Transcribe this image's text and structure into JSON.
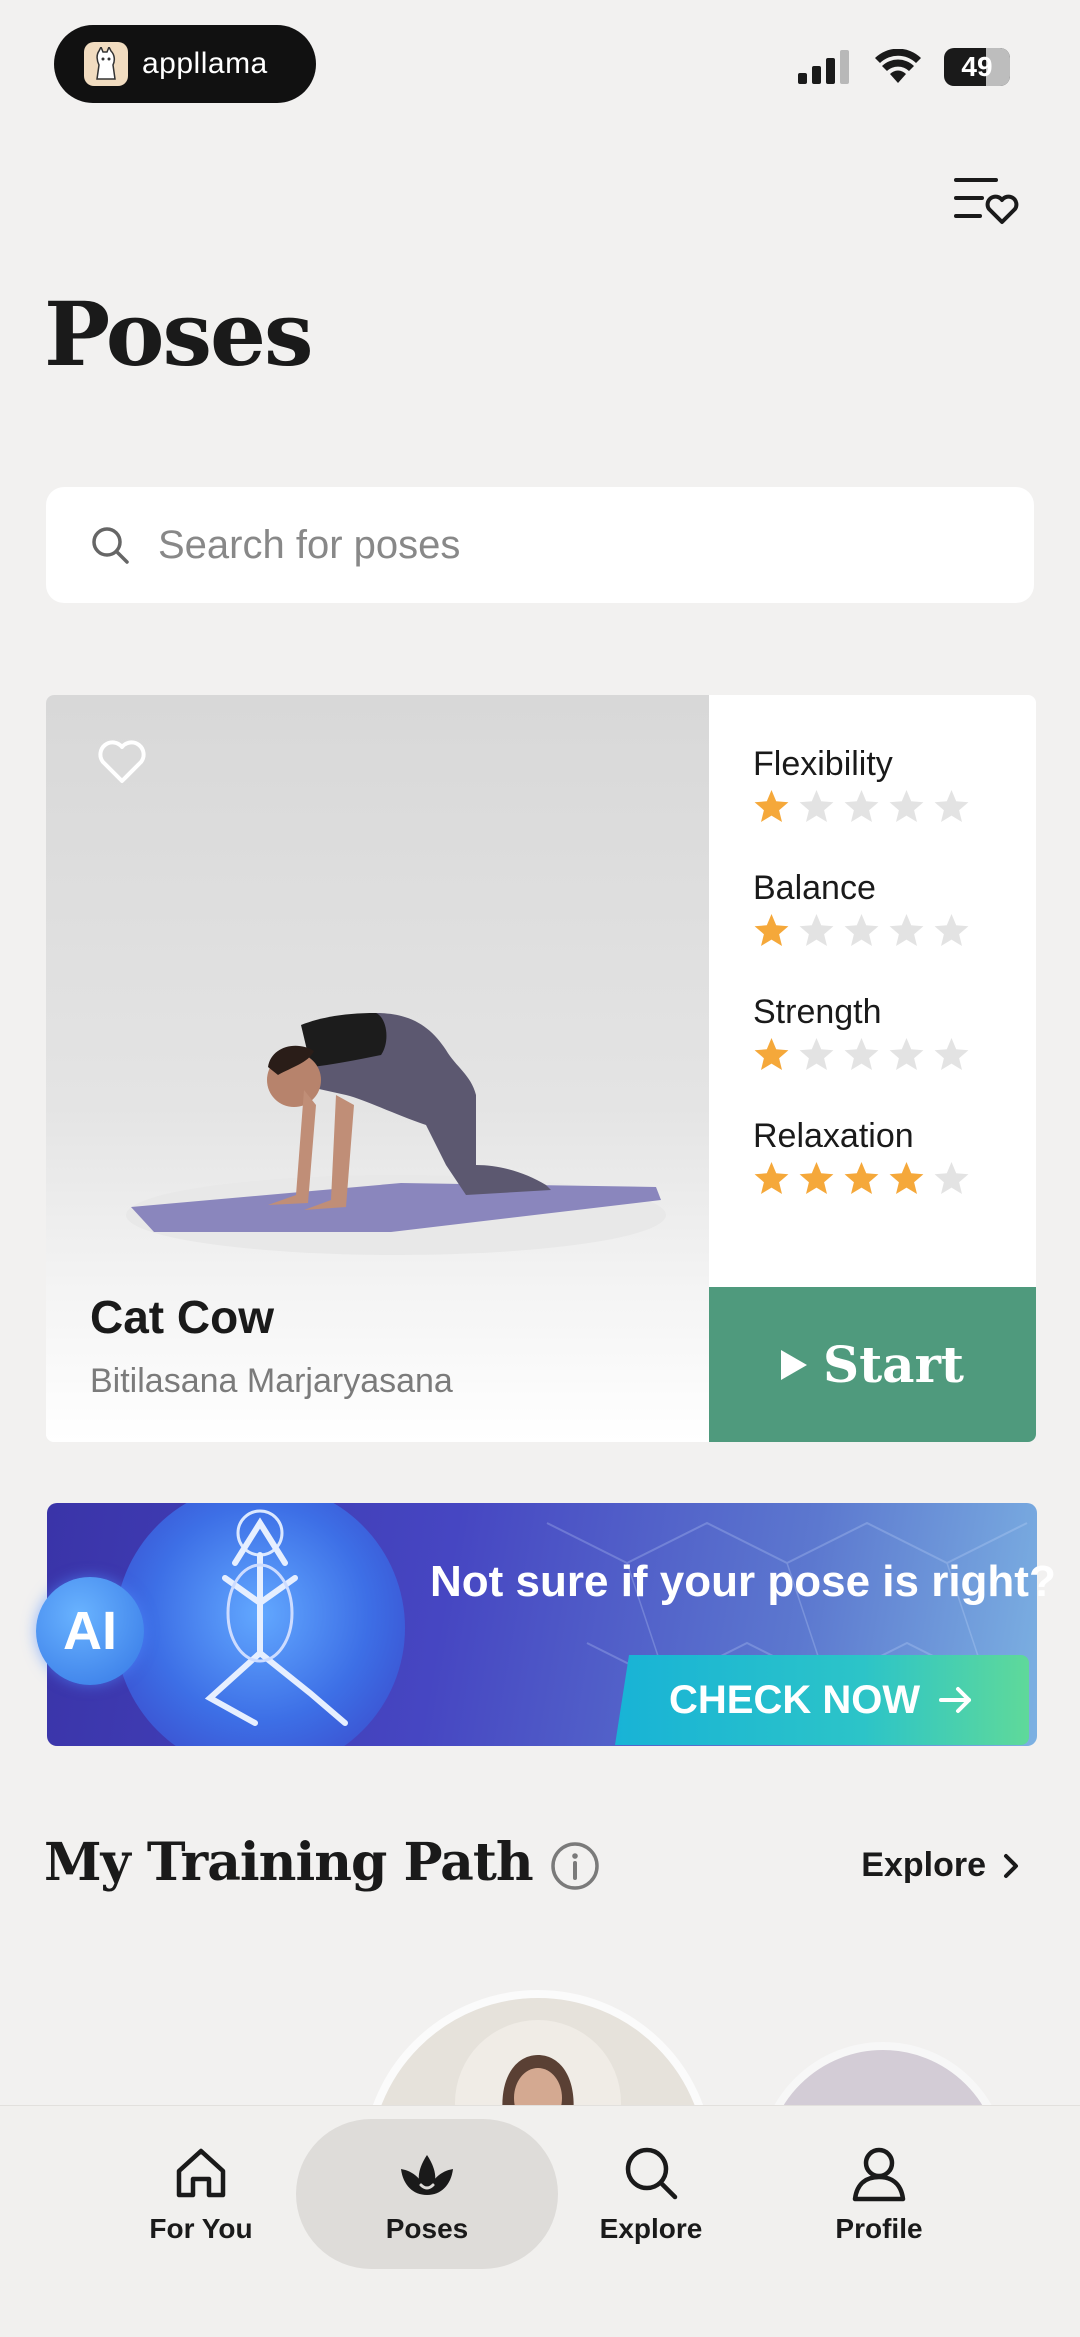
{
  "status_bar": {
    "brand_name": "appllama",
    "battery": "49"
  },
  "header": {
    "title": "Poses",
    "favorites_icon": "list-heart-icon"
  },
  "search": {
    "placeholder": "Search for poses",
    "value": ""
  },
  "featured_pose": {
    "name": "Cat Cow",
    "sanskrit": "Bitilasana Marjaryasana",
    "ratings": [
      {
        "label": "Flexibility",
        "stars": 1,
        "max": 5
      },
      {
        "label": "Balance",
        "stars": 1,
        "max": 5
      },
      {
        "label": "Strength",
        "stars": 1,
        "max": 5
      },
      {
        "label": "Relaxation",
        "stars": 4,
        "max": 5
      }
    ],
    "start_label": "Start"
  },
  "ai_banner": {
    "badge": "AI",
    "headline": "Not sure if your pose is right?",
    "cta": "CHECK NOW"
  },
  "training_path": {
    "title": "My Training Path",
    "explore_label": "Explore"
  },
  "tab_bar": {
    "tabs": [
      {
        "label": "For You",
        "icon": "home-icon"
      },
      {
        "label": "Poses",
        "icon": "lotus-icon"
      },
      {
        "label": "Explore",
        "icon": "search-icon"
      },
      {
        "label": "Profile",
        "icon": "profile-icon"
      }
    ],
    "active": "Poses"
  },
  "colors": {
    "accent_green": "#4f9a7d",
    "star_filled": "#f5a83a",
    "star_empty": "#e3e3e3",
    "banner_blue": "#4646c2"
  }
}
